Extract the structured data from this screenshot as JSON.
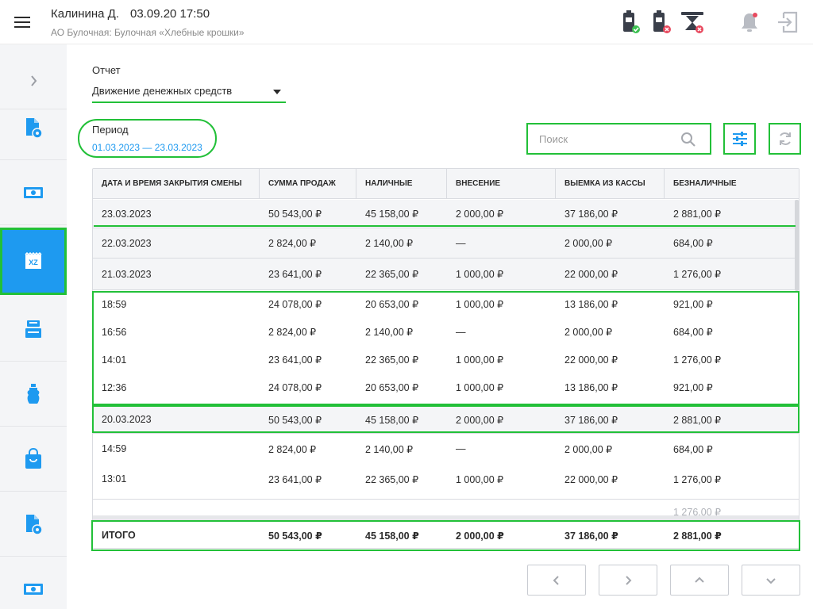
{
  "header": {
    "user_name": "Калинина Д.",
    "datetime": "03.09.20 17:50",
    "organization": "АО Булочная: Булочная «Хлебные крошки»",
    "icons": [
      "printer-ok-icon",
      "printer-error-icon",
      "scale-error-icon",
      "notification-bell-icon",
      "logout-icon"
    ]
  },
  "sidebar": {
    "items": [
      "doc-settings-icon",
      "cash-icon",
      "xz-report-icon",
      "cash-register-icon",
      "bottle-icon",
      "shopping-bag-icon",
      "doc-settings-icon",
      "cash-icon"
    ],
    "xz_label": "XZ"
  },
  "report": {
    "label": "Отчет",
    "selected": "Движение денежных средств"
  },
  "period": {
    "label": "Период",
    "range": "01.03.2023 — 23.03.2023"
  },
  "search": {
    "placeholder": "Поиск"
  },
  "table": {
    "columns": [
      "Дата и время закрытия смены",
      "Сумма продаж",
      "Наличные",
      "Внесение",
      "Выемка из кассы",
      "Безналичные"
    ],
    "rows": [
      [
        "23.03.2023",
        "50 543,00 ₽",
        "45 158,00 ₽",
        "2 000,00 ₽",
        "37 186,00 ₽",
        "2 881,00 ₽"
      ],
      [
        "22.03.2023",
        "2 824,00 ₽",
        "2 140,00 ₽",
        "—",
        "2 000,00 ₽",
        "684,00 ₽"
      ],
      [
        "21.03.2023",
        "23 641,00 ₽",
        "22 365,00 ₽",
        "1 000,00 ₽",
        "22 000,00 ₽",
        "1 276,00 ₽"
      ],
      [
        "18:59",
        "24 078,00 ₽",
        "20 653,00 ₽",
        "1 000,00 ₽",
        "13 186,00 ₽",
        "921,00 ₽"
      ],
      [
        "16:56",
        "2 824,00 ₽",
        "2 140,00 ₽",
        "—",
        "2 000,00 ₽",
        "684,00 ₽"
      ],
      [
        "14:01",
        "23 641,00 ₽",
        "22 365,00 ₽",
        "1 000,00 ₽",
        "22 000,00 ₽",
        "1 276,00 ₽"
      ],
      [
        "12:36",
        "24 078,00 ₽",
        "20 653,00 ₽",
        "1 000,00 ₽",
        "13 186,00 ₽",
        "921,00 ₽"
      ],
      [
        "20.03.2023",
        "50 543,00 ₽",
        "45 158,00 ₽",
        "2 000,00 ₽",
        "37 186,00 ₽",
        "2 881,00 ₽"
      ],
      [
        "14:59",
        "2 824,00 ₽",
        "2 140,00 ₽",
        "—",
        "2 000,00 ₽",
        "684,00 ₽"
      ],
      [
        "13:01",
        "23 641,00 ₽",
        "22 365,00 ₽",
        "1 000,00 ₽",
        "22 000,00 ₽",
        "1 276,00 ₽"
      ],
      [
        "",
        "",
        "",
        "",
        "",
        "1 276,00 ₽"
      ]
    ],
    "total": [
      "ИТОГО",
      "50 543,00 ₽",
      "45 158,00 ₽",
      "2 000,00 ₽",
      "37 186,00 ₽",
      "2 881,00 ₽"
    ]
  },
  "pagination": [
    "chevron-left-icon",
    "chevron-right-icon",
    "chevron-up-icon",
    "chevron-down-icon"
  ],
  "colors": {
    "accent": "#1e9af0",
    "highlight": "#22c038",
    "row_bg": "#f4f5f7"
  }
}
